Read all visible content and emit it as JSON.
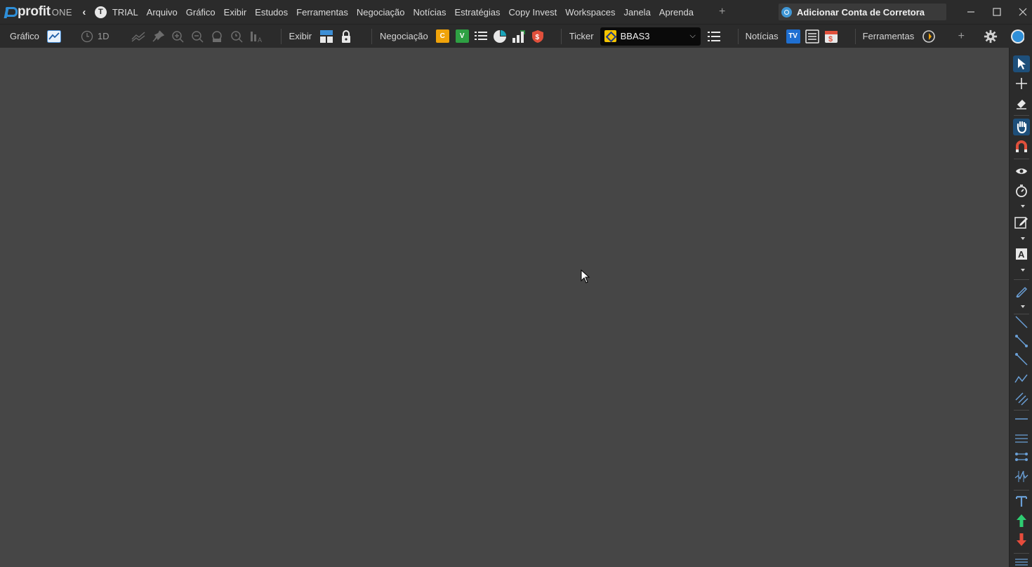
{
  "app": {
    "logo_text": "profit",
    "logo_suffix": "ONE",
    "badge_letter": "T"
  },
  "menu": [
    "TRIAL",
    "Arquivo",
    "Gráfico",
    "Exibir",
    "Estudos",
    "Ferramentas",
    "Negociação",
    "Notícias",
    "Estratégias",
    "Copy Invest",
    "Workspaces",
    "Janela",
    "Aprenda"
  ],
  "broker_button": {
    "label": "Adicionar Conta de Corretora"
  },
  "toolbar": {
    "grafico_label": "Gráfico",
    "timeframe": "1D",
    "exibir_label": "Exibir",
    "negociacao_label": "Negociação",
    "buy_badge": "C",
    "sell_badge": "V",
    "ticker_label": "Ticker",
    "ticker_value": "BBAS3",
    "noticias_label": "Notícias",
    "tv_badge": "TV",
    "ferramentas_label": "Ferramentas"
  },
  "colors": {
    "accent_blue": "#2f8fd8",
    "buy_orange": "#f0a30a",
    "sell_green": "#2ea043",
    "danger_red": "#e0503c",
    "up_green": "#2ecc71",
    "down_red": "#e74c3c",
    "chart_bg": "#464646",
    "toolbar_bg": "#2b2b2b"
  },
  "icons": {
    "toolbar": [
      "chart-type-icon",
      "clock-icon",
      "chart-lines-icon",
      "pin-icon",
      "zoom-in-icon",
      "zoom-out-icon",
      "zoom-reset-icon",
      "time-zoom-icon",
      "volume-icon",
      "layout-grid-icon",
      "lock-icon",
      "order-book-icon",
      "pie-chart-icon",
      "bar-chart-icon",
      "shield-icon",
      "list-icon",
      "news-list-icon",
      "dollar-sheet-icon",
      "refresh-icon",
      "plus-icon",
      "gear-icon",
      "compass-icon"
    ],
    "right_tools": [
      "pointer-icon",
      "crosshair-icon",
      "eraser-icon",
      "hand-icon",
      "magnet-icon",
      "eye-icon",
      "stopwatch-icon",
      "pencil-box-icon",
      "text-box-icon",
      "brush-icon",
      "line-icon",
      "ray-icon",
      "segment-icon",
      "zigzag-icon",
      "parallel-channel-icon",
      "horizontal-line-icon",
      "double-line-icon",
      "range-icon",
      "fibonacci-icon",
      "text-icon",
      "arrow-up-icon",
      "arrow-down-icon",
      "menu-lines-icon"
    ]
  }
}
